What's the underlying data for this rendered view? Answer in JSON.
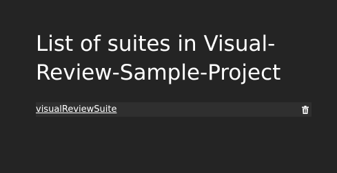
{
  "page": {
    "title": "List of suites in Visual-Review-Sample-Project"
  },
  "suites": [
    {
      "name": "visualReviewSuite",
      "delete_icon": "trash-icon"
    }
  ],
  "colors": {
    "background": "#242424",
    "row_background": "#2f2f2f",
    "text": "#ffffff"
  }
}
